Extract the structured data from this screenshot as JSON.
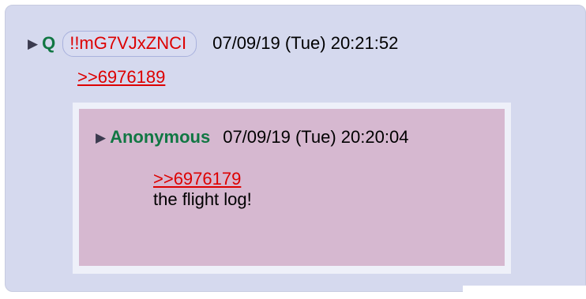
{
  "post": {
    "name": "Q",
    "tripcode": "!!mG7VJxZNCI",
    "timestamp": "07/09/19 (Tue) 20:21:52",
    "reply_link": ">>6976189"
  },
  "quoted_post": {
    "name": "Anonymous",
    "timestamp": "07/09/19 (Tue) 20:20:04",
    "reply_link": ">>6976179",
    "body": "the flight log!"
  },
  "icons": {
    "expand_arrow": "triangle-right"
  },
  "colors": {
    "name_green": "#117743",
    "link_red": "#dd0000",
    "post_bg": "#d5d9ee",
    "quote_bg": "#d6b8d0",
    "quote_border": "#eef0f9"
  }
}
